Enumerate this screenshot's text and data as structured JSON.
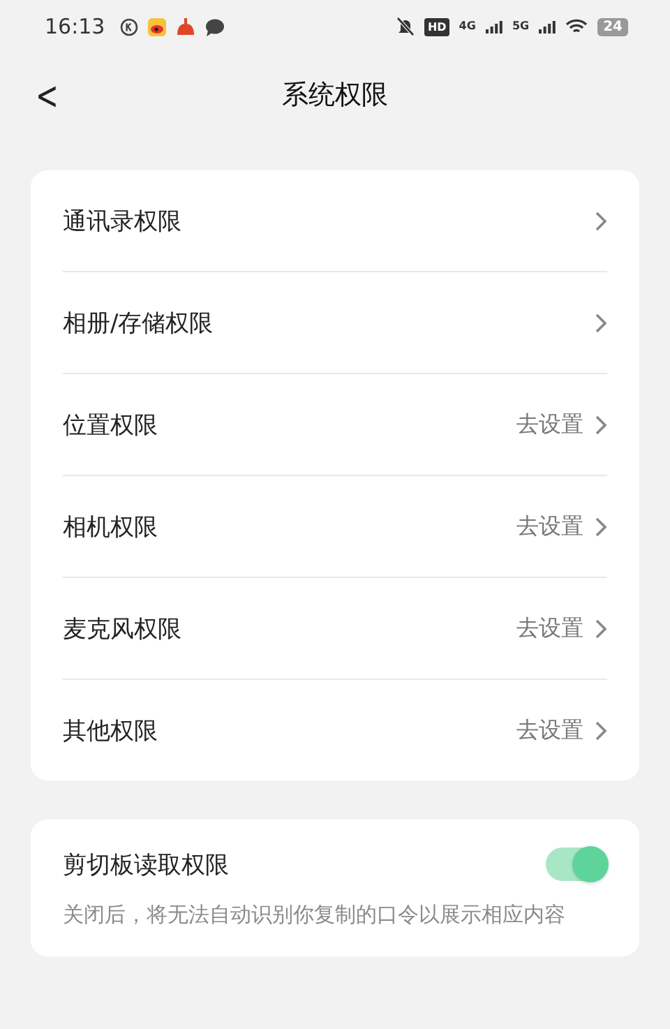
{
  "status_bar": {
    "time": "16:13",
    "hd": "HD",
    "net_1": "4G",
    "net_2": "5G",
    "battery": "24"
  },
  "header": {
    "back": "<",
    "title": "系统权限"
  },
  "permissions": [
    {
      "label": "通讯录权限"
    },
    {
      "label": "相册/存储权限"
    },
    {
      "label": "位置权限",
      "action": "去设置"
    },
    {
      "label": "相机权限",
      "action": "去设置"
    },
    {
      "label": "麦克风权限",
      "action": "去设置"
    },
    {
      "label": "其他权限",
      "action": "去设置"
    }
  ],
  "clipboard": {
    "label": "剪切板读取权限",
    "on": true,
    "description": "关闭后，将无法自动识别你复制的口令以展示相应内容"
  }
}
